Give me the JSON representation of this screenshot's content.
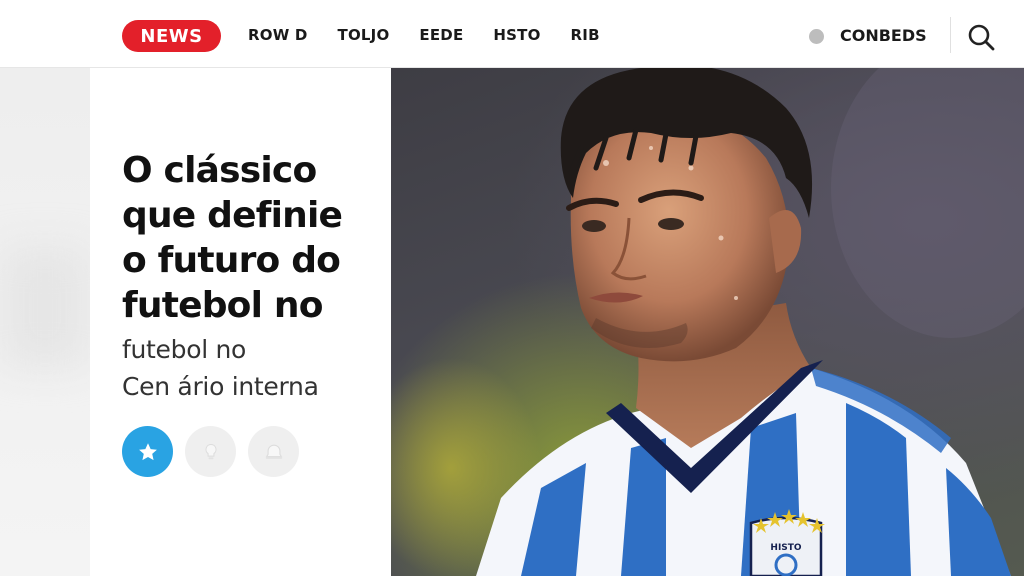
{
  "header": {
    "brand": "NEWS",
    "nav": [
      "ROW D",
      "TOLJO",
      "EEDE",
      "HSTO",
      "RIB"
    ],
    "account_label": "CONBEDS"
  },
  "article": {
    "headline_lines": [
      "O clássico",
      "que definie",
      "o futuro do",
      "futebol no"
    ],
    "subheadline_lines": [
      "futebol no",
      "Cen ário interna"
    ],
    "actions": [
      "star-icon",
      "lightbulb-icon",
      "bell-icon"
    ]
  },
  "hero": {
    "crest_text": "HISTO"
  },
  "colors": {
    "brand_red": "#e3202a",
    "accent_blue": "#29a3e3",
    "jersey_blue": "#2f6fc4",
    "jersey_navy": "#15214f"
  }
}
